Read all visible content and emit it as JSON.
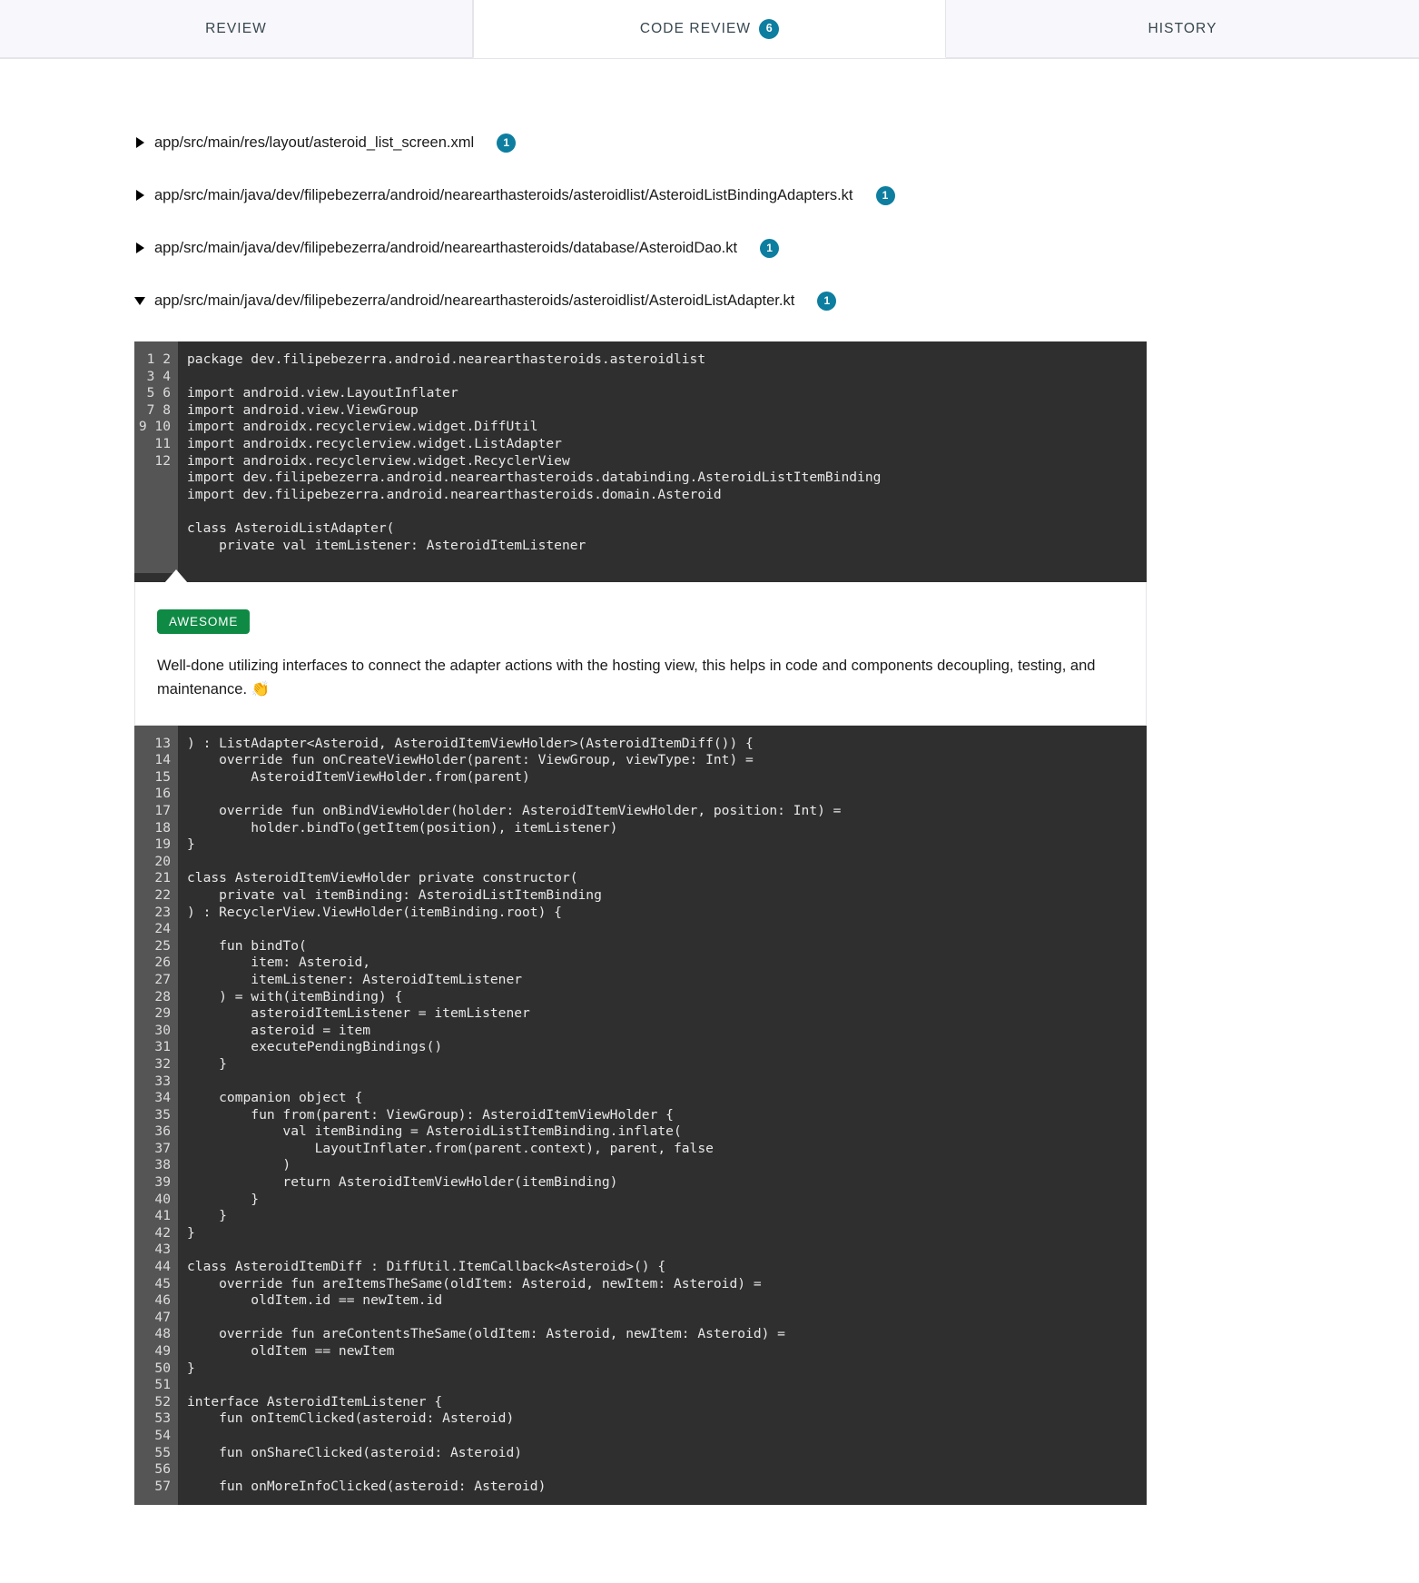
{
  "tabs": [
    {
      "label": "REVIEW",
      "count": null,
      "active": false
    },
    {
      "label": "CODE REVIEW",
      "count": "6",
      "active": true
    },
    {
      "label": "HISTORY",
      "count": null,
      "active": false
    }
  ],
  "files": [
    {
      "path": "app/src/main/res/layout/asteroid_list_screen.xml",
      "count": "1",
      "expanded": false
    },
    {
      "path": "app/src/main/java/dev/filipebezerra/android/nearearthasteroids/asteroidlist/AsteroidListBindingAdapters.kt",
      "count": "1",
      "expanded": false
    },
    {
      "path": "app/src/main/java/dev/filipebezerra/android/nearearthasteroids/database/AsteroidDao.kt",
      "count": "1",
      "expanded": false
    },
    {
      "path": "app/src/main/java/dev/filipebezerra/android/nearearthasteroids/asteroidlist/AsteroidListAdapter.kt",
      "count": "1",
      "expanded": true
    }
  ],
  "code": {
    "chunk_top": {
      "line_numbers": "1\n2\n3\n4\n5\n6\n7\n8\n9\n10\n11\n12",
      "lines": "package dev.filipebezerra.android.nearearthasteroids.asteroidlist\n\nimport android.view.LayoutInflater\nimport android.view.ViewGroup\nimport androidx.recyclerview.widget.DiffUtil\nimport androidx.recyclerview.widget.ListAdapter\nimport androidx.recyclerview.widget.RecyclerView\nimport dev.filipebezerra.android.nearearthasteroids.databinding.AsteroidListItemBinding\nimport dev.filipebezerra.android.nearearthasteroids.domain.Asteroid\n\nclass AsteroidListAdapter(\n    private val itemListener: AsteroidItemListener"
    },
    "chunk_bottom": {
      "line_numbers": "13\n14\n15\n16\n17\n18\n19\n20\n21\n22\n23\n24\n25\n26\n27\n28\n29\n30\n31\n32\n33\n34\n35\n36\n37\n38\n39\n40\n41\n42\n43\n44\n45\n46\n47\n48\n49\n50\n51\n52\n53\n54\n55\n56\n57",
      "lines": ") : ListAdapter<Asteroid, AsteroidItemViewHolder>(AsteroidItemDiff()) {\n    override fun onCreateViewHolder(parent: ViewGroup, viewType: Int) =\n        AsteroidItemViewHolder.from(parent)\n\n    override fun onBindViewHolder(holder: AsteroidItemViewHolder, position: Int) =\n        holder.bindTo(getItem(position), itemListener)\n}\n\nclass AsteroidItemViewHolder private constructor(\n    private val itemBinding: AsteroidListItemBinding\n) : RecyclerView.ViewHolder(itemBinding.root) {\n\n    fun bindTo(\n        item: Asteroid,\n        itemListener: AsteroidItemListener\n    ) = with(itemBinding) {\n        asteroidItemListener = itemListener\n        asteroid = item\n        executePendingBindings()\n    }\n\n    companion object {\n        fun from(parent: ViewGroup): AsteroidItemViewHolder {\n            val itemBinding = AsteroidListItemBinding.inflate(\n                LayoutInflater.from(parent.context), parent, false\n            )\n            return AsteroidItemViewHolder(itemBinding)\n        }\n    }\n}\n\nclass AsteroidItemDiff : DiffUtil.ItemCallback<Asteroid>() {\n    override fun areItemsTheSame(oldItem: Asteroid, newItem: Asteroid) =\n        oldItem.id == newItem.id\n\n    override fun areContentsTheSame(oldItem: Asteroid, newItem: Asteroid) =\n        oldItem == newItem\n}\n\ninterface AsteroidItemListener {\n    fun onItemClicked(asteroid: Asteroid)\n\n    fun onShareClicked(asteroid: Asteroid)\n\n    fun onMoreInfoClicked(asteroid: Asteroid)"
    }
  },
  "comment": {
    "tag": "AWESOME",
    "text": "Well-done utilizing interfaces to connect the adapter actions with the hosting view, this helps in code and components decoupling, testing, and maintenance. 👏"
  },
  "colors": {
    "accent": "#0d7ea0",
    "tag_green": "#0f8a45",
    "code_bg": "#2f2f2f",
    "gutter_bg": "#555555",
    "tab_inactive_bg": "#f8f7fb",
    "border": "#e3e5ea"
  }
}
